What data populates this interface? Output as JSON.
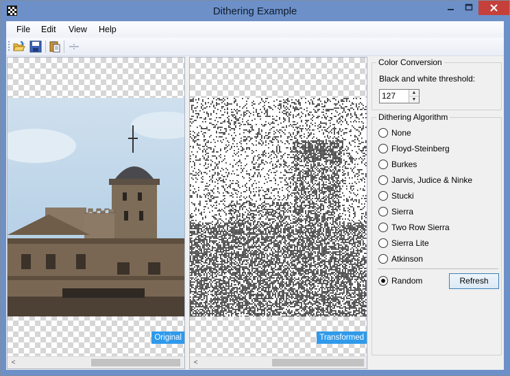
{
  "window": {
    "title": "Dithering Example",
    "close_glyph": "×",
    "min_glyph": "—",
    "max_glyph": "□"
  },
  "menu": {
    "items": [
      "File",
      "Edit",
      "View",
      "Help"
    ]
  },
  "toolbar": {
    "icons": [
      "open-folder-icon",
      "save-icon",
      "paste-icon",
      "split-icon"
    ]
  },
  "panels": {
    "original": {
      "badge": "Original"
    },
    "transformed": {
      "badge": "Transformed"
    }
  },
  "scroll": {
    "left": "<",
    "right": ">"
  },
  "color_conversion": {
    "legend": "Color Conversion",
    "threshold_label": "Black and white threshold:",
    "threshold_value": "127",
    "up": "▲",
    "down": "▼"
  },
  "dithering": {
    "legend": "Dithering Algorithm",
    "options": [
      "None",
      "Floyd-Steinberg",
      "Burkes",
      "Jarvis, Judice & Ninke",
      "Stucki",
      "Sierra",
      "Two Row Sierra",
      "Sierra Lite",
      "Atkinson"
    ],
    "random_label": "Random",
    "selected": "Random",
    "refresh_label": "Refresh"
  },
  "colors": {
    "titlebar": "#6d90c8",
    "close": "#c6403b",
    "badge": "#2f9aeb",
    "chrome": "#f0f0f0"
  }
}
